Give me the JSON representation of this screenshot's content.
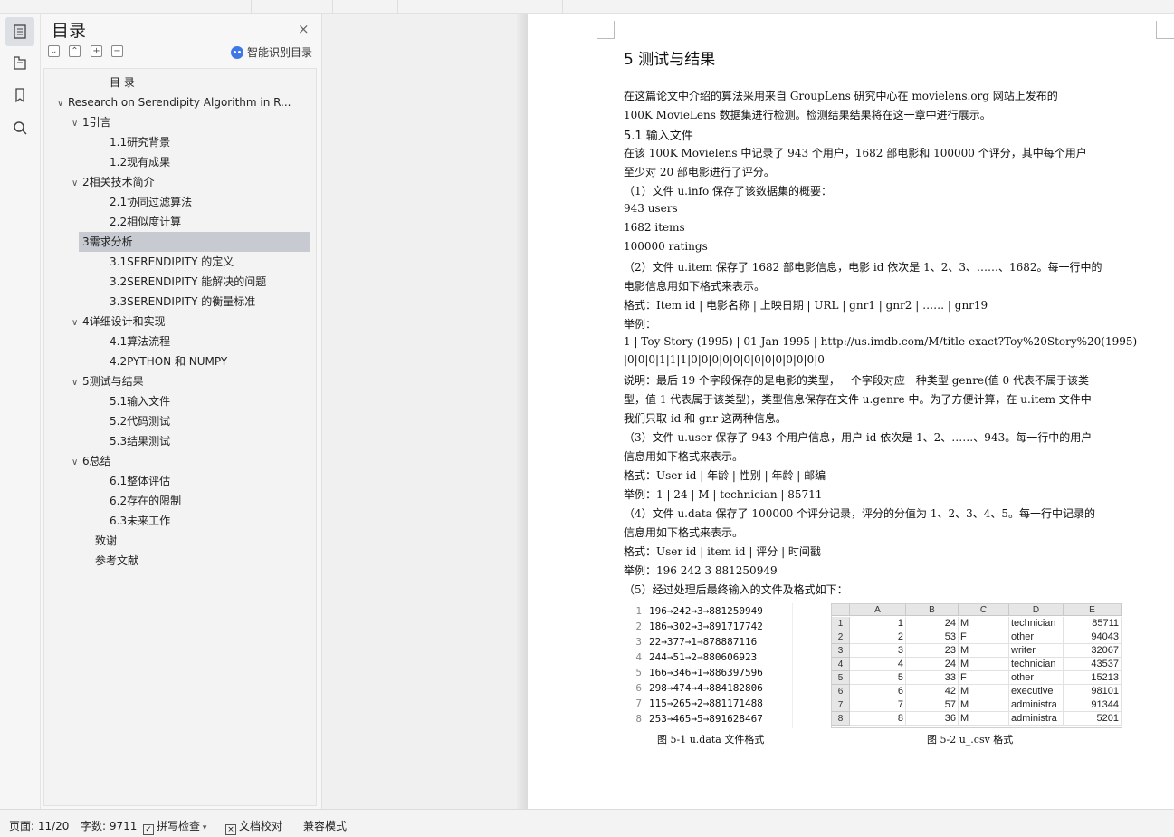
{
  "toc": {
    "title": "目录",
    "close_icon": "×",
    "smart_label": "智能识别目录",
    "tools": [
      "collapse-all",
      "expand-all",
      "add-heading",
      "remove-heading"
    ],
    "items": [
      {
        "label": "目  录",
        "level": 2,
        "chev": ""
      },
      {
        "label": "Research on Serendipity Algorithm in R...",
        "level": 0,
        "chev": "∨"
      },
      {
        "label": "1引言",
        "level": 1,
        "chev": "∨"
      },
      {
        "label": "1.1研究背景",
        "level": 2,
        "chev": ""
      },
      {
        "label": "1.2现有成果",
        "level": 2,
        "chev": ""
      },
      {
        "label": "2相关技术简介",
        "level": 1,
        "chev": "∨"
      },
      {
        "label": "2.1协同过滤算法",
        "level": 2,
        "chev": ""
      },
      {
        "label": "2.2相似度计算",
        "level": 2,
        "chev": ""
      },
      {
        "label": "3需求分析",
        "level": 1,
        "chev": "∨",
        "selected": true
      },
      {
        "label": "3.1SERENDIPITY 的定义",
        "level": 2,
        "chev": ""
      },
      {
        "label": "3.2SERENDIPITY 能解决的问题",
        "level": 2,
        "chev": ""
      },
      {
        "label": "3.3SERENDIPITY 的衡量标准",
        "level": 2,
        "chev": ""
      },
      {
        "label": "4详细设计和实现",
        "level": 1,
        "chev": "∨"
      },
      {
        "label": "4.1算法流程",
        "level": 2,
        "chev": ""
      },
      {
        "label": "4.2PYTHON 和 NUMPY",
        "level": 2,
        "chev": ""
      },
      {
        "label": "5测试与结果",
        "level": 1,
        "chev": "∨"
      },
      {
        "label": "5.1输入文件",
        "level": 2,
        "chev": ""
      },
      {
        "label": "5.2代码测试",
        "level": 2,
        "chev": ""
      },
      {
        "label": "5.3结果测试",
        "level": 2,
        "chev": ""
      },
      {
        "label": "6总结",
        "level": 1,
        "chev": "∨"
      },
      {
        "label": "6.1整体评估",
        "level": 2,
        "chev": ""
      },
      {
        "label": "6.2存在的限制",
        "level": 2,
        "chev": ""
      },
      {
        "label": "6.3未来工作",
        "level": 2,
        "chev": ""
      },
      {
        "label": "致谢",
        "level": 1.5,
        "chev": ""
      },
      {
        "label": "参考文献",
        "level": 1.5,
        "chev": ""
      }
    ]
  },
  "rail": {
    "icons": [
      "toc-icon",
      "outline-icon",
      "bookmark-icon",
      "search-icon"
    ]
  },
  "doc": {
    "section_title": "5  测试与结果",
    "subsection_title": "5.1  输入文件",
    "lines": [
      "      在这篇论文中介绍的算法采用来自  GroupLens 研究中心在  movielens.org 网站上发布的",
      "100K MovieLens 数据集进行检测。检测结果结果将在这一章中进行展示。",
      "      在该 100K Movielens 中记录了 943 个用户，1682 部电影和 100000 个评分，其中每个用户",
      "至少对 20 部电影进行了评分。",
      "（1）文件  u.info 保存了该数据集的概要：",
      "943  users",
      "1682  items",
      "100000  ratings",
      "（2）文件 u.item 保存了 1682 部电影信息，电影 id 依次是 1、2、3、……、1682。每一行中的",
      "电影信息用如下格式来表示。",
      "格式：Item id | 电影名称  | 上映日期  | URL | gnr1 | gnr2 | ……  | gnr19",
      "举例：",
      "1 | Toy Story (1995) | 01-Jan-1995 | http://us.imdb.com/M/title-exact?Toy%20Story%20(1995)",
      "|0|0|0|1|1|1|0|0|0|0|0|0|0|0|0|0|0|0|0",
      "说明：最后 19 个字段保存的是电影的类型，一个字段对应一种类型 genre(值 0 代表不属于该类",
      "型，值 1 代表属于该类型)，类型信息保存在文件  u.genre 中。为了方便计算，在 u.item 文件中",
      "我们只取 id 和 gnr 这两种信息。",
      "（3）文件 u.user 保存了 943 个用户信息，用户 id 依次是 1、2、……、943。每一行中的用户",
      "信息用如下格式来表示。",
      "格式：User id | 年龄  | 性别  |  年龄  |  邮编",
      "举例：1 | 24 | M | technician | 85711",
      "（4）文件  u.data 保存了  100000 个评分记录，评分的分值为  1、2、3、4、5。每一行中记录的",
      "信息用如下格式来表示。",
      "格式：User id | item id |  评分  |  时间戳",
      "举例：196    242    3    881250949",
      "（5）经过处理后最终输入的文件及格式如下："
    ],
    "code_lines": [
      {
        "n": "1",
        "t": "196→242→3→881250949"
      },
      {
        "n": "2",
        "t": "186→302→3→891717742"
      },
      {
        "n": "3",
        "t": "22→377→1→878887116"
      },
      {
        "n": "4",
        "t": "244→51→2→880606923"
      },
      {
        "n": "5",
        "t": "166→346→1→886397596"
      },
      {
        "n": "6",
        "t": "298→474→4→884182806"
      },
      {
        "n": "7",
        "t": "115→265→2→881171488"
      },
      {
        "n": "8",
        "t": "253→465→5→891628467"
      }
    ],
    "sheet": {
      "cols": [
        "A",
        "B",
        "C",
        "D",
        "E"
      ],
      "rows": [
        [
          "1",
          "1",
          "24",
          "M",
          "technician",
          "85711"
        ],
        [
          "2",
          "2",
          "53",
          "F",
          "other",
          "94043"
        ],
        [
          "3",
          "3",
          "23",
          "M",
          "writer",
          "32067"
        ],
        [
          "4",
          "4",
          "24",
          "M",
          "technician",
          "43537"
        ],
        [
          "5",
          "5",
          "33",
          "F",
          "other",
          "15213"
        ],
        [
          "6",
          "6",
          "42",
          "M",
          "executive",
          "98101"
        ],
        [
          "7",
          "7",
          "57",
          "M",
          "administra",
          "91344"
        ],
        [
          "8",
          "8",
          "36",
          "M",
          "administra",
          "5201"
        ]
      ]
    },
    "caption_1": "图 5-1  u.data 文件格式",
    "caption_2": "图 5-2  u_.csv 格式"
  },
  "status": {
    "page": "页面: 11/20",
    "words": "字数: 9711",
    "spell": "拼写检查",
    "proof": "文档校对",
    "compat": "兼容模式"
  }
}
